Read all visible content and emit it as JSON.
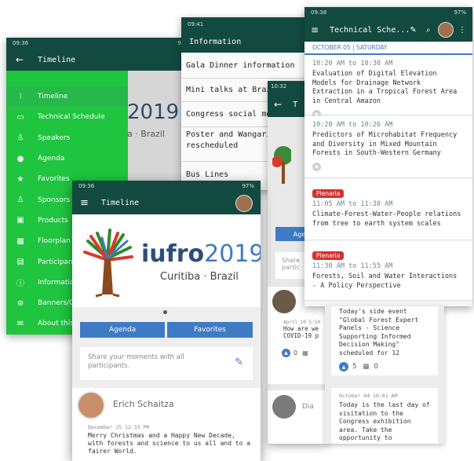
{
  "timeline_drawer": {
    "status_time": "09:36",
    "battery": "97%",
    "title": "Timeline",
    "items": [
      {
        "label": "Timeline",
        "icon": "timeline-icon",
        "active": true
      },
      {
        "label": "Technical Schedule",
        "icon": "calendar-icon"
      },
      {
        "label": "Speakers",
        "icon": "person-icon"
      },
      {
        "label": "Agenda",
        "icon": "clock-icon"
      },
      {
        "label": "Favorites",
        "icon": "star-icon"
      },
      {
        "label": "Sponsors",
        "icon": "sponsor-icon"
      },
      {
        "label": "Products",
        "icon": "product-icon"
      },
      {
        "label": "Floorplan",
        "icon": "map-icon"
      },
      {
        "label": "Participan",
        "icon": "people-icon"
      },
      {
        "label": "Informatio",
        "icon": "info-icon"
      },
      {
        "label": "Banners/C",
        "icon": "banner-icon"
      },
      {
        "label": "About this",
        "icon": "about-icon"
      }
    ],
    "background_text": "2019",
    "background_sub": "a · Brazil"
  },
  "information_screen": {
    "status_time": "09:41",
    "title": "Information",
    "items": [
      "Gala Dinner information",
      "Mini talks at Brazilia",
      "Congress social media",
      "Poster and Wangari M",
      "rescheduled",
      "Bus Lines"
    ]
  },
  "mid_screen": {
    "status_time": "10:32",
    "title_initial": "T",
    "button_partial": "Agen",
    "share_partial_1": "Share",
    "share_partial_2": "partic",
    "post_date": "April 10 5:59",
    "post_text_1": "How are we",
    "post_text_2": "COVID-19 p",
    "count": "0",
    "bottom_name": "Dia"
  },
  "technical_schedule": {
    "status_time": "09:38",
    "battery": "97%",
    "title": "Technical Sche...",
    "date_header": "OCTOBER 05 | SATURDAY",
    "sessions": [
      {
        "time": "10:20 AM to 10:30 AM",
        "title": "Evaluation of Digital Elevation Models for Drainage Network Extraction in a Tropical Forest Area in Central Amazon",
        "tag": ""
      },
      {
        "time": "10:20 AM to 10:26 AM",
        "title": "Predictors of Microhabitat Frequency and Diversity in Mixed Mountain Forests in South-Western Germany",
        "tag": ""
      },
      {
        "time": "11:05 AM to 11:30 AM",
        "title": "Climate-Forest-Water-People relations from tree to earth system scales",
        "tag": "Plenaria"
      },
      {
        "time": "11:30 AM to 11:55 AM",
        "title": "Forests, Soil and Water Interactions - A Policy Perspective",
        "tag": "Plenaria"
      }
    ],
    "post1": {
      "text": "Today's side event \"Global Forest Expert Panels - Science Supporting Informed Decision Making\" scheduled for 12",
      "likes": "5",
      "comments": "0"
    },
    "post2": {
      "date": "October 04 10:01 AM",
      "text": "Today is the last day of visitation to the Congress exhibition area. Take the opportunity to"
    }
  },
  "timeline_main": {
    "status_time": "09:36",
    "battery": "97%",
    "title": "Timeline",
    "logo_word": "iufro",
    "logo_year": "2019",
    "logo_city": "Curitiba · Brazil",
    "agenda_button": "Agenda",
    "favorites_button": "Favorites",
    "share_placeholder": "Share your moments with all participants.",
    "post": {
      "author": "Erich Schaitza",
      "date": "December 25 12:33 PM",
      "text": "Merry Christmas and a Happy New Decade, with forests and science to us all and to a fairer World."
    }
  },
  "colors": {
    "dark_green": "#124a3f",
    "drawer_green": "#1fc43f",
    "blue": "#3f7bc4",
    "plenaria_red": "#d63232"
  }
}
